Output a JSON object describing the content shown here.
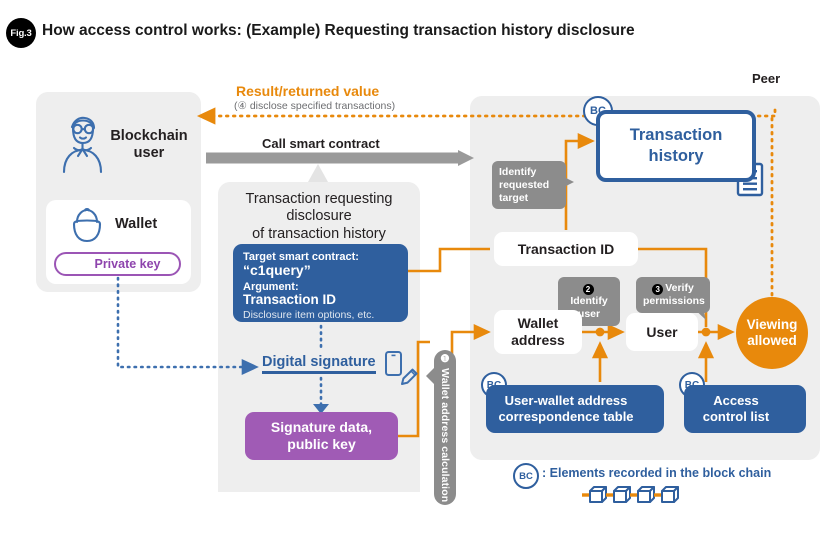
{
  "figure": {
    "badge": "Fig.3",
    "title": "How access control works: (Example) Requesting transaction history disclosure"
  },
  "colors": {
    "orange": "#E8890C",
    "blue": "#2F5F9E",
    "purple": "#A05BB5",
    "grey_panel": "#EEEEEE",
    "grey_callout": "#8C8C8C",
    "grey_arrow": "#9A9A9A"
  },
  "user_panel": {
    "avatar_icon": "blockchain-user-avatar-icon",
    "user_label": "Blockchain\nuser",
    "user_label_line1": "Blockchain",
    "user_label_line2": "user",
    "wallet_icon": "wallet-purse-icon",
    "wallet_label": "Wallet",
    "private_key_icon": "key-icon",
    "private_key_label": "Private key"
  },
  "flows": {
    "result_title": "Result/returned value",
    "result_sub": "(④ disclose specified transactions)",
    "call_label": "Call smart contract"
  },
  "transaction_panel": {
    "title_line1": "Transaction requesting",
    "title_line2": "disclosure",
    "title_line3": "of transaction history",
    "contract_box": {
      "target_label": "Target smart contract:",
      "target_value": "“c1query”",
      "argument_label": "Argument:",
      "argument_value": "Transaction ID",
      "options": "Disclosure item options, etc."
    },
    "digital_signature_label": "Digital signature",
    "digital_signature_icons": [
      "device-icon",
      "pencil-icon"
    ],
    "signature_box_line1": "Signature data,",
    "signature_box_line2": "public key"
  },
  "wallet_calculation_callout": {
    "number": "❶",
    "label": "Wallet address calculation"
  },
  "peer_panel": {
    "label": "Peer",
    "transaction_history": {
      "bc_badge": "BC",
      "line1": "Transaction",
      "line2": "history",
      "doc_icon": "document-icon"
    },
    "callouts": [
      {
        "name": "identify-requested-target",
        "number": "",
        "line1": "Identify",
        "line2": "requested",
        "line3": "target"
      },
      {
        "name": "identify-user",
        "number": "❷",
        "line1": "Identify",
        "line2": "user"
      },
      {
        "name": "verify-permissions",
        "number": "❸",
        "line1": "Verify",
        "line2": "permissions"
      }
    ],
    "boxes": {
      "transaction_id": "Transaction ID",
      "wallet_address_line1": "Wallet",
      "wallet_address_line2": "address",
      "user": "User",
      "viewing_allowed_line1": "Viewing",
      "viewing_allowed_line2": "allowed"
    },
    "blue_boxes": [
      {
        "name": "user-wallet-correspondence-table",
        "bc_badge": "BC",
        "line1": "User-wallet address",
        "line2": "correspondence table",
        "doc_icon": "document-icon"
      },
      {
        "name": "access-control-list",
        "bc_badge": "BC",
        "line1": "Access",
        "line2": "control list",
        "doc_icon": "document-icon"
      }
    ]
  },
  "legend": {
    "badge": "BC",
    "text": ": Elements recorded in the block chain",
    "blocks_icon": "block-chain-blocks-icon"
  }
}
